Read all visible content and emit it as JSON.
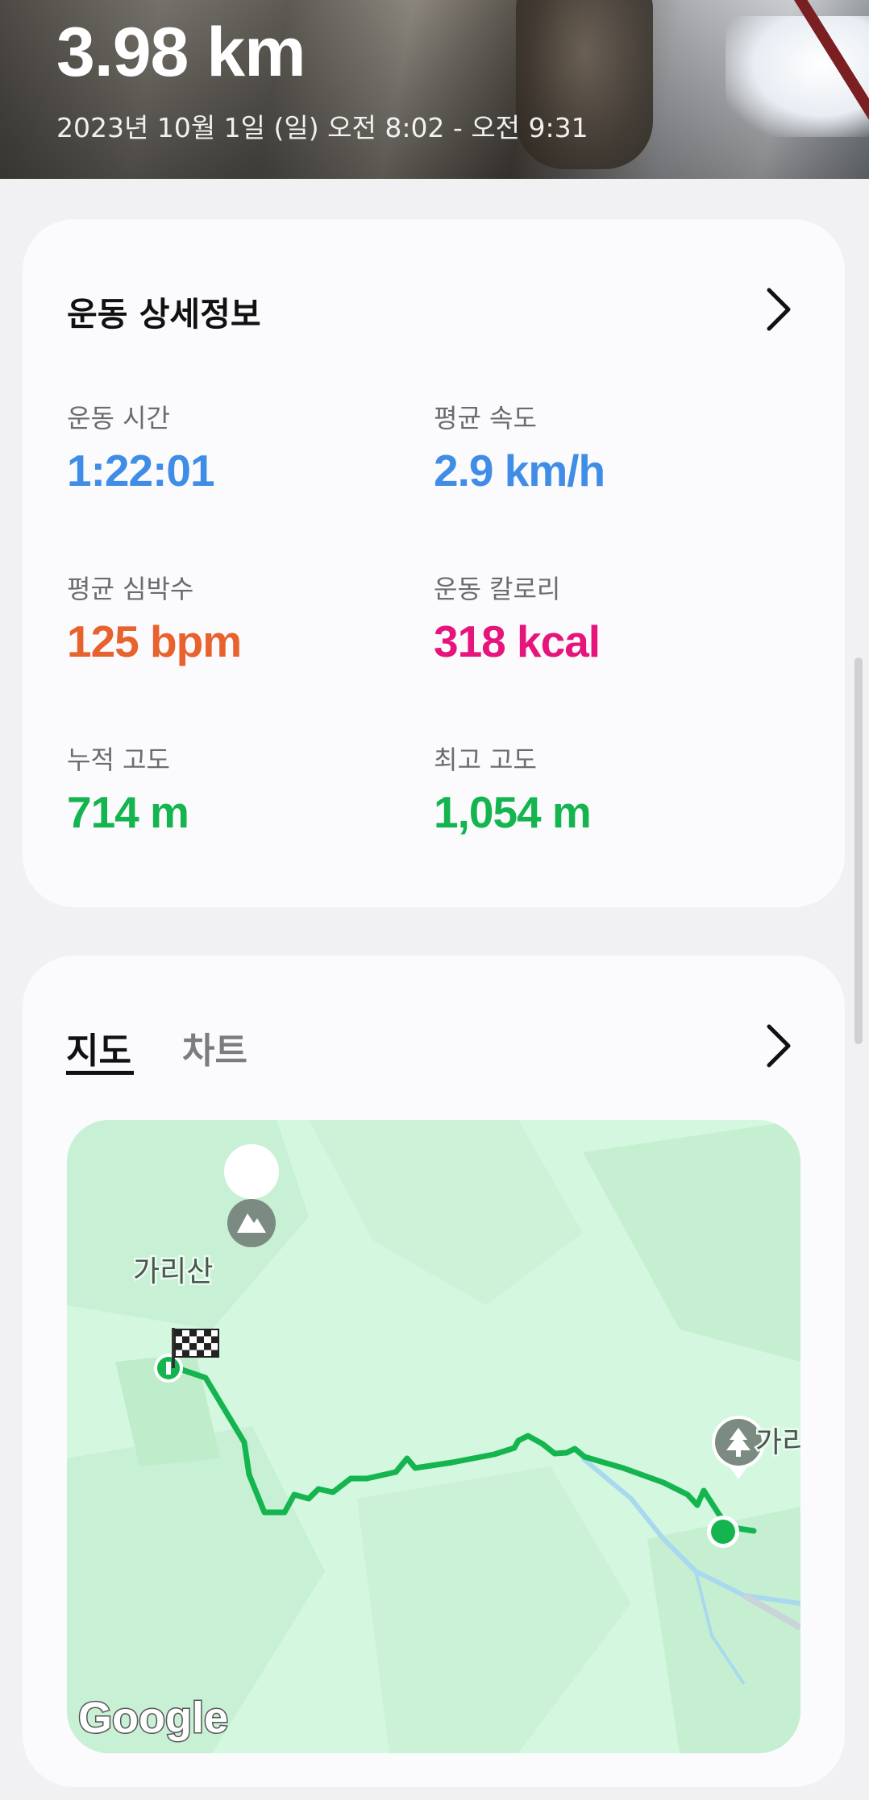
{
  "hero": {
    "distance": "3.98 km",
    "datetime": "2023년 10월 1일 (일) 오전 8:02 - 오전 9:31"
  },
  "details": {
    "title": "운동 상세정보",
    "stats": [
      {
        "label": "운동 시간",
        "value": "1:22:01",
        "color": "#3f8de6"
      },
      {
        "label": "평균 속도",
        "value": "2.9 km/h",
        "color": "#3f8de6"
      },
      {
        "label": "평균 심박수",
        "value": "125 bpm",
        "color": "#e8622d"
      },
      {
        "label": "운동 칼로리",
        "value": "318 kcal",
        "color": "#e5157b"
      },
      {
        "label": "누적 고도",
        "value": "714 m",
        "color": "#14b54f"
      },
      {
        "label": "최고 고도",
        "value": "1,054 m",
        "color": "#14b54f"
      }
    ]
  },
  "map_card": {
    "tabs": [
      {
        "label": "지도",
        "active": true
      },
      {
        "label": "차트",
        "active": false
      }
    ],
    "map": {
      "poi_mountain": "가리산",
      "poi_forest": "가리",
      "attribution": "Google",
      "route_color": "#14b54f"
    }
  },
  "colors": {
    "accent_blue": "#3f8de6",
    "heart_orange": "#e8622d",
    "calorie_pink": "#e5157b",
    "altitude_green": "#14b54f"
  }
}
